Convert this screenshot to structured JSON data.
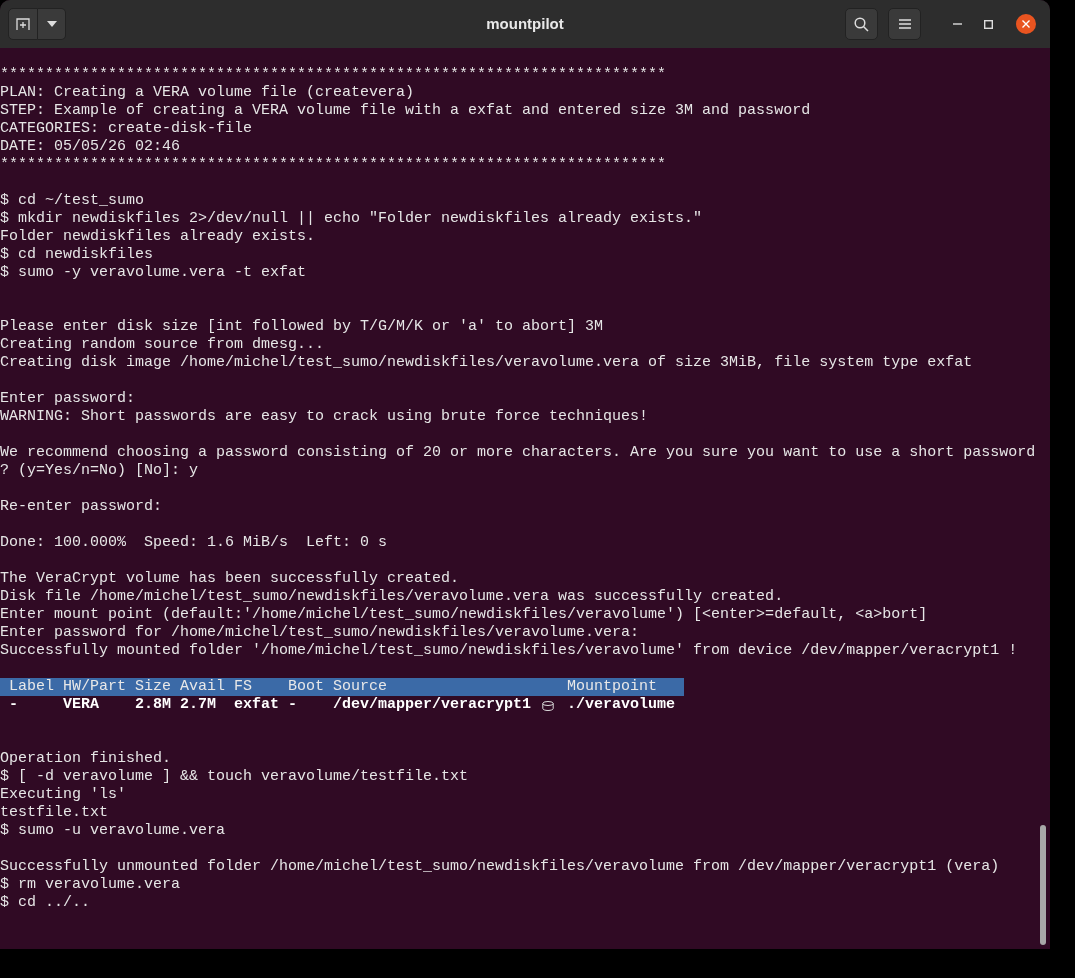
{
  "window": {
    "title": "mountpilot"
  },
  "output_before": [
    {
      "kind": "text",
      "text": "**************************************************************************"
    },
    {
      "kind": "text",
      "text": "PLAN: Creating a VERA volume file (createvera)"
    },
    {
      "kind": "text",
      "text": "STEP: Example of creating a VERA volume file with a exfat and entered size 3M and password"
    },
    {
      "kind": "text",
      "text": "CATEGORIES: create-disk-file"
    },
    {
      "kind": "text",
      "text": "DATE: 05/05/26 02:46"
    },
    {
      "kind": "text",
      "text": "**************************************************************************"
    },
    {
      "kind": "blank"
    },
    {
      "kind": "text",
      "text": "$ cd ~/test_sumo"
    },
    {
      "kind": "text",
      "text": "$ mkdir newdiskfiles 2>/dev/null || echo \"Folder newdiskfiles already exists.\""
    },
    {
      "kind": "text",
      "text": "Folder newdiskfiles already exists."
    },
    {
      "kind": "text",
      "text": "$ cd newdiskfiles"
    },
    {
      "kind": "text",
      "text": "$ sumo -y veravolume.vera -t exfat"
    },
    {
      "kind": "blank"
    },
    {
      "kind": "blank"
    },
    {
      "kind": "text",
      "text": "Please enter disk size [int followed by T/G/M/K or 'a' to abort] 3M"
    },
    {
      "kind": "text",
      "text": "Creating random source from dmesg..."
    },
    {
      "kind": "text",
      "text": "Creating disk image /home/michel/test_sumo/newdiskfiles/veravolume.vera of size 3MiB, file system type exfat"
    },
    {
      "kind": "blank"
    },
    {
      "kind": "text",
      "text": "Enter password:"
    },
    {
      "kind": "text",
      "text": "WARNING: Short passwords are easy to crack using brute force techniques!"
    },
    {
      "kind": "blank"
    },
    {
      "kind": "text",
      "text": "We recommend choosing a password consisting of 20 or more characters. Are you sure you want to use a short password"
    },
    {
      "kind": "text",
      "text": "? (y=Yes/n=No) [No]: y"
    },
    {
      "kind": "blank"
    },
    {
      "kind": "text",
      "text": "Re-enter password:"
    },
    {
      "kind": "blank"
    },
    {
      "kind": "text",
      "text": "Done: 100.000%  Speed: 1.6 MiB/s  Left: 0 s"
    },
    {
      "kind": "blank"
    },
    {
      "kind": "text",
      "text": "The VeraCrypt volume has been successfully created."
    },
    {
      "kind": "text",
      "text": "Disk file /home/michel/test_sumo/newdiskfiles/veravolume.vera was successfully created."
    },
    {
      "kind": "text",
      "text": "Enter mount point (default:'/home/michel/test_sumo/newdiskfiles/veravolume') [<enter>=default, <a>bort]"
    },
    {
      "kind": "text",
      "text": "Enter password for /home/michel/test_sumo/newdiskfiles/veravolume.vera:"
    },
    {
      "kind": "text",
      "text": "Successfully mounted folder '/home/michel/test_sumo/newdiskfiles/veravolume' from device /dev/mapper/veracrypt1 !"
    },
    {
      "kind": "blank"
    }
  ],
  "table": {
    "columns": [
      "Label",
      "HW/Part",
      "Size",
      "Avail",
      "FS",
      "Boot",
      "Source",
      "Mountpoint"
    ],
    "rows": [
      [
        "-",
        "VERA",
        "2.8M",
        "2.7M",
        "exfat",
        "-",
        "/dev/mapper/veracrypt1",
        "./veravolume"
      ]
    ]
  },
  "output_after": [
    {
      "kind": "blank"
    },
    {
      "kind": "blank"
    },
    {
      "kind": "text",
      "text": "Operation finished."
    },
    {
      "kind": "text",
      "text": "$ [ -d veravolume ] && touch veravolume/testfile.txt"
    },
    {
      "kind": "text",
      "text": "Executing 'ls'"
    },
    {
      "kind": "text",
      "text": "testfile.txt"
    },
    {
      "kind": "text",
      "text": "$ sumo -u veravolume.vera"
    },
    {
      "kind": "blank"
    },
    {
      "kind": "text",
      "text": "Successfully unmounted folder /home/michel/test_sumo/newdiskfiles/veravolume from /dev/mapper/veracrypt1 (vera)"
    },
    {
      "kind": "text",
      "text": "$ rm veravolume.vera"
    },
    {
      "kind": "text",
      "text": "$ cd ../.."
    }
  ]
}
